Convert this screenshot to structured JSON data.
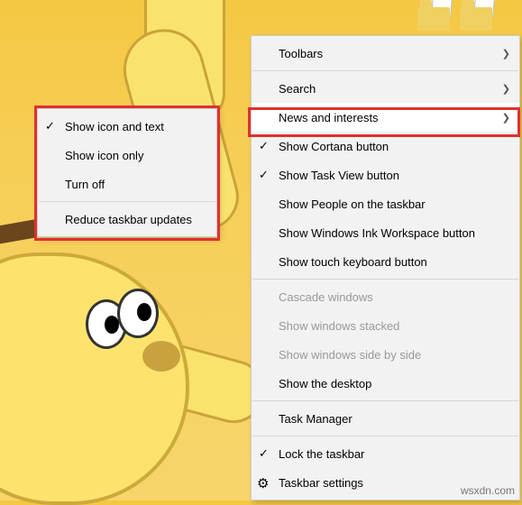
{
  "mainMenu": {
    "toolbars": "Toolbars",
    "search": "Search",
    "newsInterests": "News and interests",
    "showCortana": "Show Cortana button",
    "showTaskView": "Show Task View button",
    "showPeople": "Show People on the taskbar",
    "showInk": "Show Windows Ink Workspace button",
    "showTouchKb": "Show touch keyboard button",
    "cascade": "Cascade windows",
    "stacked": "Show windows stacked",
    "sideBySide": "Show windows side by side",
    "showDesktop": "Show the desktop",
    "taskManager": "Task Manager",
    "lockTaskbar": "Lock the taskbar",
    "taskbarSettings": "Taskbar settings"
  },
  "subMenu": {
    "iconText": "Show icon and text",
    "iconOnly": "Show icon only",
    "turnOff": "Turn off",
    "reduceUpdates": "Reduce taskbar updates"
  },
  "watermark": "wsxdn.com"
}
